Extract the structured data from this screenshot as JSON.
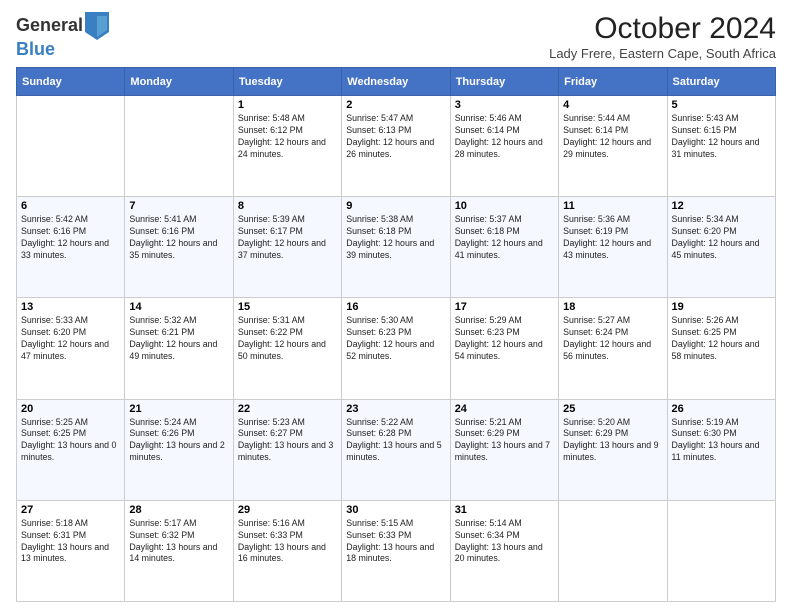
{
  "logo": {
    "general": "General",
    "blue": "Blue"
  },
  "header": {
    "month": "October 2024",
    "location": "Lady Frere, Eastern Cape, South Africa"
  },
  "days_of_week": [
    "Sunday",
    "Monday",
    "Tuesday",
    "Wednesday",
    "Thursday",
    "Friday",
    "Saturday"
  ],
  "weeks": [
    [
      {
        "day": "",
        "info": ""
      },
      {
        "day": "",
        "info": ""
      },
      {
        "day": "1",
        "info": "Sunrise: 5:48 AM\nSunset: 6:12 PM\nDaylight: 12 hours and 24 minutes."
      },
      {
        "day": "2",
        "info": "Sunrise: 5:47 AM\nSunset: 6:13 PM\nDaylight: 12 hours and 26 minutes."
      },
      {
        "day": "3",
        "info": "Sunrise: 5:46 AM\nSunset: 6:14 PM\nDaylight: 12 hours and 28 minutes."
      },
      {
        "day": "4",
        "info": "Sunrise: 5:44 AM\nSunset: 6:14 PM\nDaylight: 12 hours and 29 minutes."
      },
      {
        "day": "5",
        "info": "Sunrise: 5:43 AM\nSunset: 6:15 PM\nDaylight: 12 hours and 31 minutes."
      }
    ],
    [
      {
        "day": "6",
        "info": "Sunrise: 5:42 AM\nSunset: 6:16 PM\nDaylight: 12 hours and 33 minutes."
      },
      {
        "day": "7",
        "info": "Sunrise: 5:41 AM\nSunset: 6:16 PM\nDaylight: 12 hours and 35 minutes."
      },
      {
        "day": "8",
        "info": "Sunrise: 5:39 AM\nSunset: 6:17 PM\nDaylight: 12 hours and 37 minutes."
      },
      {
        "day": "9",
        "info": "Sunrise: 5:38 AM\nSunset: 6:18 PM\nDaylight: 12 hours and 39 minutes."
      },
      {
        "day": "10",
        "info": "Sunrise: 5:37 AM\nSunset: 6:18 PM\nDaylight: 12 hours and 41 minutes."
      },
      {
        "day": "11",
        "info": "Sunrise: 5:36 AM\nSunset: 6:19 PM\nDaylight: 12 hours and 43 minutes."
      },
      {
        "day": "12",
        "info": "Sunrise: 5:34 AM\nSunset: 6:20 PM\nDaylight: 12 hours and 45 minutes."
      }
    ],
    [
      {
        "day": "13",
        "info": "Sunrise: 5:33 AM\nSunset: 6:20 PM\nDaylight: 12 hours and 47 minutes."
      },
      {
        "day": "14",
        "info": "Sunrise: 5:32 AM\nSunset: 6:21 PM\nDaylight: 12 hours and 49 minutes."
      },
      {
        "day": "15",
        "info": "Sunrise: 5:31 AM\nSunset: 6:22 PM\nDaylight: 12 hours and 50 minutes."
      },
      {
        "day": "16",
        "info": "Sunrise: 5:30 AM\nSunset: 6:23 PM\nDaylight: 12 hours and 52 minutes."
      },
      {
        "day": "17",
        "info": "Sunrise: 5:29 AM\nSunset: 6:23 PM\nDaylight: 12 hours and 54 minutes."
      },
      {
        "day": "18",
        "info": "Sunrise: 5:27 AM\nSunset: 6:24 PM\nDaylight: 12 hours and 56 minutes."
      },
      {
        "day": "19",
        "info": "Sunrise: 5:26 AM\nSunset: 6:25 PM\nDaylight: 12 hours and 58 minutes."
      }
    ],
    [
      {
        "day": "20",
        "info": "Sunrise: 5:25 AM\nSunset: 6:25 PM\nDaylight: 13 hours and 0 minutes."
      },
      {
        "day": "21",
        "info": "Sunrise: 5:24 AM\nSunset: 6:26 PM\nDaylight: 13 hours and 2 minutes."
      },
      {
        "day": "22",
        "info": "Sunrise: 5:23 AM\nSunset: 6:27 PM\nDaylight: 13 hours and 3 minutes."
      },
      {
        "day": "23",
        "info": "Sunrise: 5:22 AM\nSunset: 6:28 PM\nDaylight: 13 hours and 5 minutes."
      },
      {
        "day": "24",
        "info": "Sunrise: 5:21 AM\nSunset: 6:29 PM\nDaylight: 13 hours and 7 minutes."
      },
      {
        "day": "25",
        "info": "Sunrise: 5:20 AM\nSunset: 6:29 PM\nDaylight: 13 hours and 9 minutes."
      },
      {
        "day": "26",
        "info": "Sunrise: 5:19 AM\nSunset: 6:30 PM\nDaylight: 13 hours and 11 minutes."
      }
    ],
    [
      {
        "day": "27",
        "info": "Sunrise: 5:18 AM\nSunset: 6:31 PM\nDaylight: 13 hours and 13 minutes."
      },
      {
        "day": "28",
        "info": "Sunrise: 5:17 AM\nSunset: 6:32 PM\nDaylight: 13 hours and 14 minutes."
      },
      {
        "day": "29",
        "info": "Sunrise: 5:16 AM\nSunset: 6:33 PM\nDaylight: 13 hours and 16 minutes."
      },
      {
        "day": "30",
        "info": "Sunrise: 5:15 AM\nSunset: 6:33 PM\nDaylight: 13 hours and 18 minutes."
      },
      {
        "day": "31",
        "info": "Sunrise: 5:14 AM\nSunset: 6:34 PM\nDaylight: 13 hours and 20 minutes."
      },
      {
        "day": "",
        "info": ""
      },
      {
        "day": "",
        "info": ""
      }
    ]
  ]
}
